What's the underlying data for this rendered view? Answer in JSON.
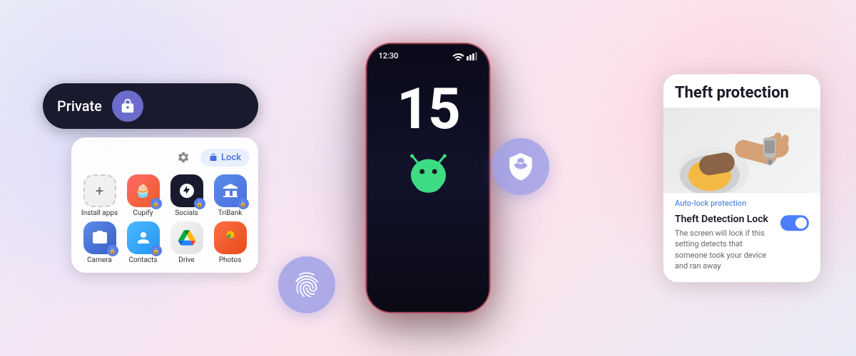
{
  "background": {
    "glow_left_color": "rgba(200,210,255,0.5)",
    "glow_right_color": "rgba(255,180,200,0.4)"
  },
  "phone": {
    "status_bar": {
      "time": "12:30"
    },
    "big_number": "15"
  },
  "left_panel": {
    "private_label": "Private",
    "lock_button_label": "Lock",
    "app_grid": {
      "top_row": [
        {
          "label": "Install apps",
          "type": "install"
        },
        {
          "label": "Cupify",
          "type": "cupify"
        },
        {
          "label": "Socials",
          "type": "socials"
        },
        {
          "label": "TriBank",
          "type": "tribank"
        }
      ],
      "bottom_row": [
        {
          "label": "Camera",
          "type": "camera"
        },
        {
          "label": "Contacts",
          "type": "contacts"
        },
        {
          "label": "Drive",
          "type": "drive"
        },
        {
          "label": "Photos",
          "type": "photos"
        }
      ]
    }
  },
  "right_panel": {
    "title": "Theft protection",
    "auto_lock_label": "Auto-lock protection",
    "theft_detection": {
      "title": "Theft Detection Lock",
      "description": "The screen will lock if this setting detects that someone took your device and ran away",
      "toggle_enabled": true
    }
  },
  "icons": {
    "fingerprint": "⬡",
    "shield": "🛡",
    "lock": "🔒",
    "gear": "⚙"
  }
}
